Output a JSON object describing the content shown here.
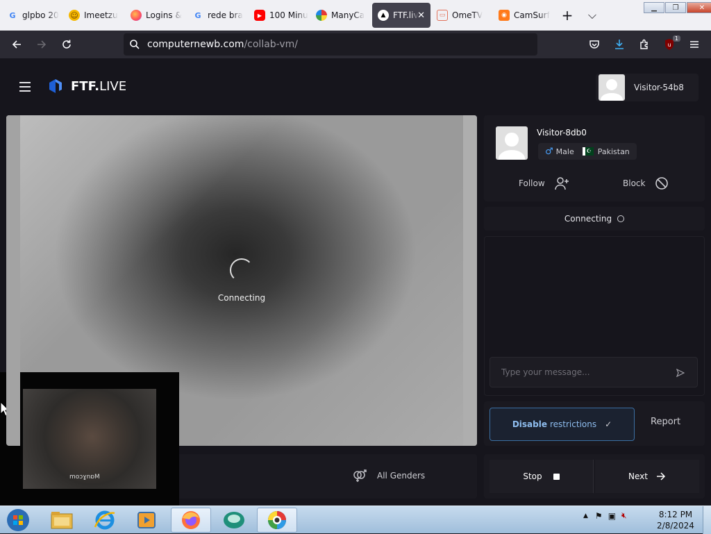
{
  "browser": {
    "tabs": [
      {
        "title": "glpbo 20",
        "icon": "google-icon",
        "active": false
      },
      {
        "title": "Imeetzu",
        "icon": "imeetzu-icon",
        "active": false
      },
      {
        "title": "Logins &",
        "icon": "firefox-icon",
        "active": false
      },
      {
        "title": "rede bra",
        "icon": "google-icon",
        "active": false
      },
      {
        "title": "100 Minu",
        "icon": "youtube-icon",
        "active": false
      },
      {
        "title": "ManyCa",
        "icon": "manycam-icon",
        "active": false
      },
      {
        "title": "FTF.liv",
        "icon": "ftf-icon",
        "active": true
      },
      {
        "title": "OmeTV",
        "icon": "ometv-icon",
        "active": false
      },
      {
        "title": "CamSurf",
        "icon": "camsurf-icon",
        "active": false
      }
    ],
    "new_tab_symbol": "+",
    "tab_list_symbol": "⌵",
    "close_symbol": "✕",
    "url_host": "computernewb.com",
    "url_path": "/collab-vm/",
    "extension_badge": "1"
  },
  "site": {
    "logo_bold": "FTF.",
    "logo_light": "LIVE",
    "current_user": "Visitor-54b8"
  },
  "video": {
    "status": "Connecting",
    "watermark": "moɔɣnɒM"
  },
  "filters": {
    "gender_label": "All Genders"
  },
  "partner": {
    "name": "Visitor-8db0",
    "gender": "Male",
    "country": "Pakistan",
    "follow_label": "Follow",
    "block_label": "Block"
  },
  "chat": {
    "status": "Connecting",
    "input_placeholder": "Type your message..."
  },
  "actions": {
    "restrict_bold": "Disable",
    "restrict_rest": "restrictions",
    "report_label": "Report",
    "stop_label": "Stop",
    "next_label": "Next"
  },
  "taskbar": {
    "time": "8:12 PM",
    "date": "2/8/2024"
  },
  "colors": {
    "page_bg": "#16151c",
    "panel_bg": "#1a1920",
    "accent_blue": "#3b6fa3",
    "restrict_text": "#8fbef0",
    "pakistan_green": "#01411c",
    "male_blue": "#4aa3ff"
  }
}
